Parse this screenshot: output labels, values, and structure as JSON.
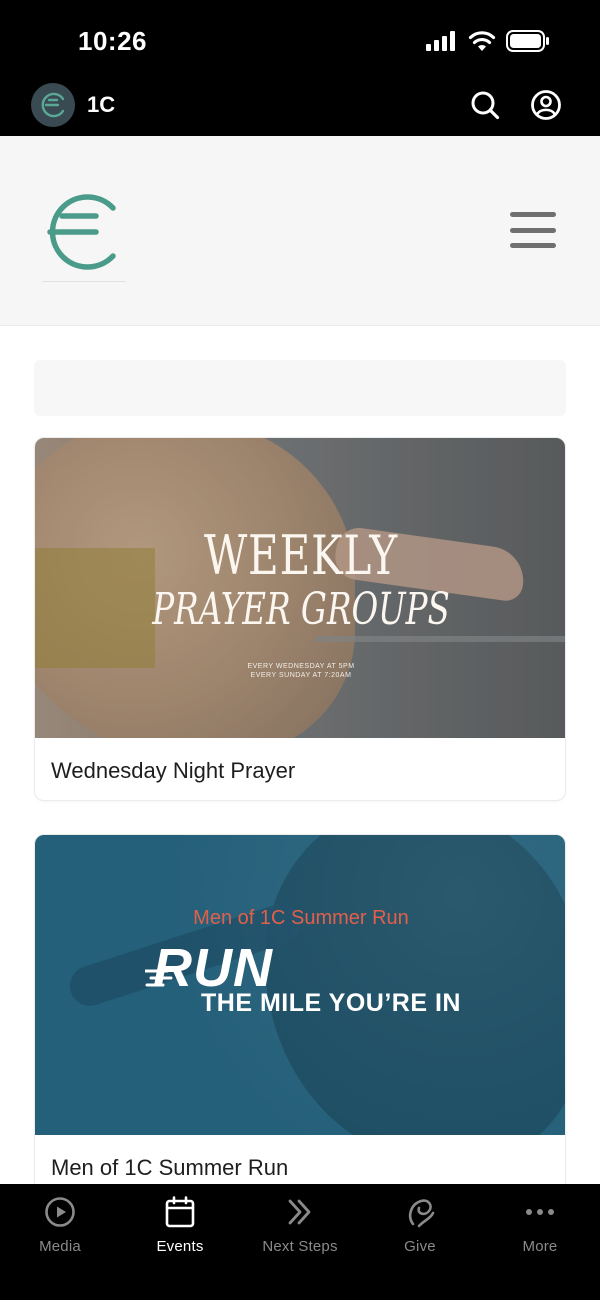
{
  "status_bar": {
    "time": "10:26",
    "icons": [
      "cellular-signal-icon",
      "wifi-icon",
      "battery-icon"
    ]
  },
  "app_header": {
    "app_name": "1C",
    "icons": [
      "app-logo-icon",
      "search-icon",
      "profile-icon"
    ]
  },
  "site_header": {
    "logo_icon": "church-logo-icon",
    "menu_icon": "hamburger-menu-icon",
    "brand_color": "#4a9b8a"
  },
  "cards": [
    {
      "title": "Wednesday Night Prayer",
      "image": {
        "headline": "WEEKLY",
        "subheadline": "PRAYER GROUPS",
        "schedule_line_1": "EVERY WEDNESDAY AT 5PM",
        "schedule_line_2": "EVERY SUNDAY AT 7:20AM"
      }
    },
    {
      "title": "Men of 1C Summer Run",
      "image": {
        "kicker": "Men of 1C Summer Run",
        "headline": "RUN",
        "tagline": "THE MILE YOU’RE IN",
        "kicker_color": "#e2604a",
        "background_color": "#25607a"
      }
    }
  ],
  "tab_bar": {
    "active_tab": "Events",
    "tabs": [
      {
        "label": "Media",
        "icon": "play-circle-icon"
      },
      {
        "label": "Events",
        "icon": "calendar-icon"
      },
      {
        "label": "Next Steps",
        "icon": "double-chevron-icon"
      },
      {
        "label": "Give",
        "icon": "give-icon"
      },
      {
        "label": "More",
        "icon": "more-dots-icon"
      }
    ]
  }
}
